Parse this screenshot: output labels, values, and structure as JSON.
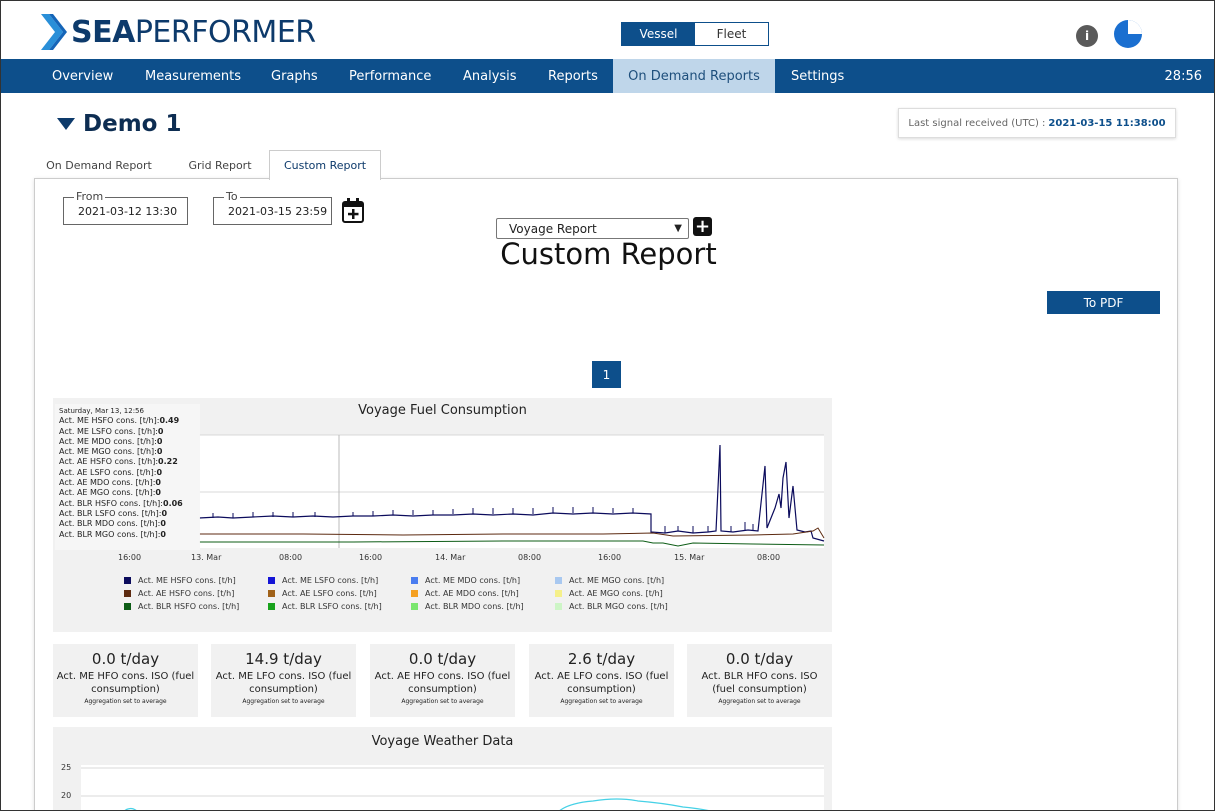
{
  "header": {
    "brand_bold": "SEA",
    "brand_rest": "PERFORMER",
    "toggle": {
      "vessel": "Vessel",
      "fleet": "Fleet",
      "selected": "Vessel"
    },
    "info_icon": "info-icon",
    "user_icon": "pie-avatar-icon"
  },
  "nav": {
    "items": [
      "Overview",
      "Measurements",
      "Graphs",
      "Performance",
      "Analysis",
      "Reports",
      "On Demand Reports",
      "Settings"
    ],
    "active": "On Demand Reports",
    "clock": "28:56"
  },
  "page": {
    "title": "Demo 1",
    "signal_label": "Last signal received (UTC) :",
    "signal_value": "2021-03-15 11:38:00"
  },
  "tabs": [
    "On Demand Report",
    "Grid Report",
    "Custom Report"
  ],
  "active_tab": "Custom Report",
  "form": {
    "from_label": "From",
    "from_value": "2021-03-12 13:30",
    "to_label": "To",
    "to_value": "2021-03-15 23:59",
    "report_select": "Voyage Report",
    "add_icon": "plus-icon",
    "calendar_icon": "calendar-add-icon"
  },
  "report": {
    "title": "Custom Report",
    "pdf_button": "To PDF",
    "page_number": "1"
  },
  "fuel_chart": {
    "title": "Voyage Fuel Consumption",
    "tooltip": {
      "header": "Saturday, Mar 13, 12:56",
      "rows": [
        {
          "label": "Act. ME HSFO cons. [t/h]:",
          "value": "0.49"
        },
        {
          "label": "Act. ME LSFO cons. [t/h]:",
          "value": "0"
        },
        {
          "label": "Act. ME MDO cons. [t/h]:",
          "value": "0"
        },
        {
          "label": "Act. ME MGO cons. [t/h]:",
          "value": "0"
        },
        {
          "label": "Act. AE HSFO cons. [t/h]:",
          "value": "0.22"
        },
        {
          "label": "Act. AE LSFO cons. [t/h]:",
          "value": "0"
        },
        {
          "label": "Act. AE MDO cons. [t/h]:",
          "value": "0"
        },
        {
          "label": "Act. AE MGO cons. [t/h]:",
          "value": "0"
        },
        {
          "label": "Act. BLR HSFO cons. [t/h]:",
          "value": "0.06"
        },
        {
          "label": "Act. BLR LSFO cons. [t/h]:",
          "value": "0"
        },
        {
          "label": "Act. BLR MDO cons. [t/h]:",
          "value": "0"
        },
        {
          "label": "Act. BLR MGO cons. [t/h]:",
          "value": "0"
        }
      ]
    },
    "x_ticks": [
      "16:00",
      "13. Mar",
      "08:00",
      "16:00",
      "14. Mar",
      "08:00",
      "16:00",
      "15. Mar",
      "08:00"
    ],
    "legend": [
      {
        "label": "Act. ME HSFO cons. [t/h]",
        "color": "#0b0b5c"
      },
      {
        "label": "Act. ME LSFO cons. [t/h]",
        "color": "#1414d6"
      },
      {
        "label": "Act. ME MDO cons. [t/h]",
        "color": "#4a7df0"
      },
      {
        "label": "Act. ME MGO cons. [t/h]",
        "color": "#a8c8f0"
      },
      {
        "label": "Act. AE HSFO cons. [t/h]",
        "color": "#5c2a10"
      },
      {
        "label": "Act. AE LSFO cons. [t/h]",
        "color": "#a0621a"
      },
      {
        "label": "Act. AE MDO cons. [t/h]",
        "color": "#f5a020"
      },
      {
        "label": "Act. AE MGO cons. [t/h]",
        "color": "#f5f08a"
      },
      {
        "label": "Act. BLR HSFO cons. [t/h]",
        "color": "#0d5c16"
      },
      {
        "label": "Act. BLR LSFO cons. [t/h]",
        "color": "#18a21c"
      },
      {
        "label": "Act. BLR MDO cons. [t/h]",
        "color": "#7ae66e"
      },
      {
        "label": "Act. BLR MGO cons. [t/h]",
        "color": "#cdf5c6"
      }
    ]
  },
  "metrics": [
    {
      "value": "0.0 t/day",
      "label": "Act. ME HFO cons. ISO (fuel consumption)",
      "agg": "Aggregation set to average"
    },
    {
      "value": "14.9 t/day",
      "label": "Act. ME LFO cons. ISO (fuel consumption)",
      "agg": "Aggregation set to average"
    },
    {
      "value": "0.0 t/day",
      "label": "Act. AE HFO cons. ISO (fuel consumption)",
      "agg": "Aggregation set to average"
    },
    {
      "value": "2.6 t/day",
      "label": "Act. AE LFO cons. ISO (fuel consumption)",
      "agg": "Aggregation set to average"
    },
    {
      "value": "0.0 t/day",
      "label": "Act. BLR HFO cons. ISO (fuel consumption)",
      "agg": "Aggregation set to average"
    }
  ],
  "weather_chart": {
    "title": "Voyage Weather Data",
    "y_ticks": [
      "25",
      "20"
    ]
  }
}
